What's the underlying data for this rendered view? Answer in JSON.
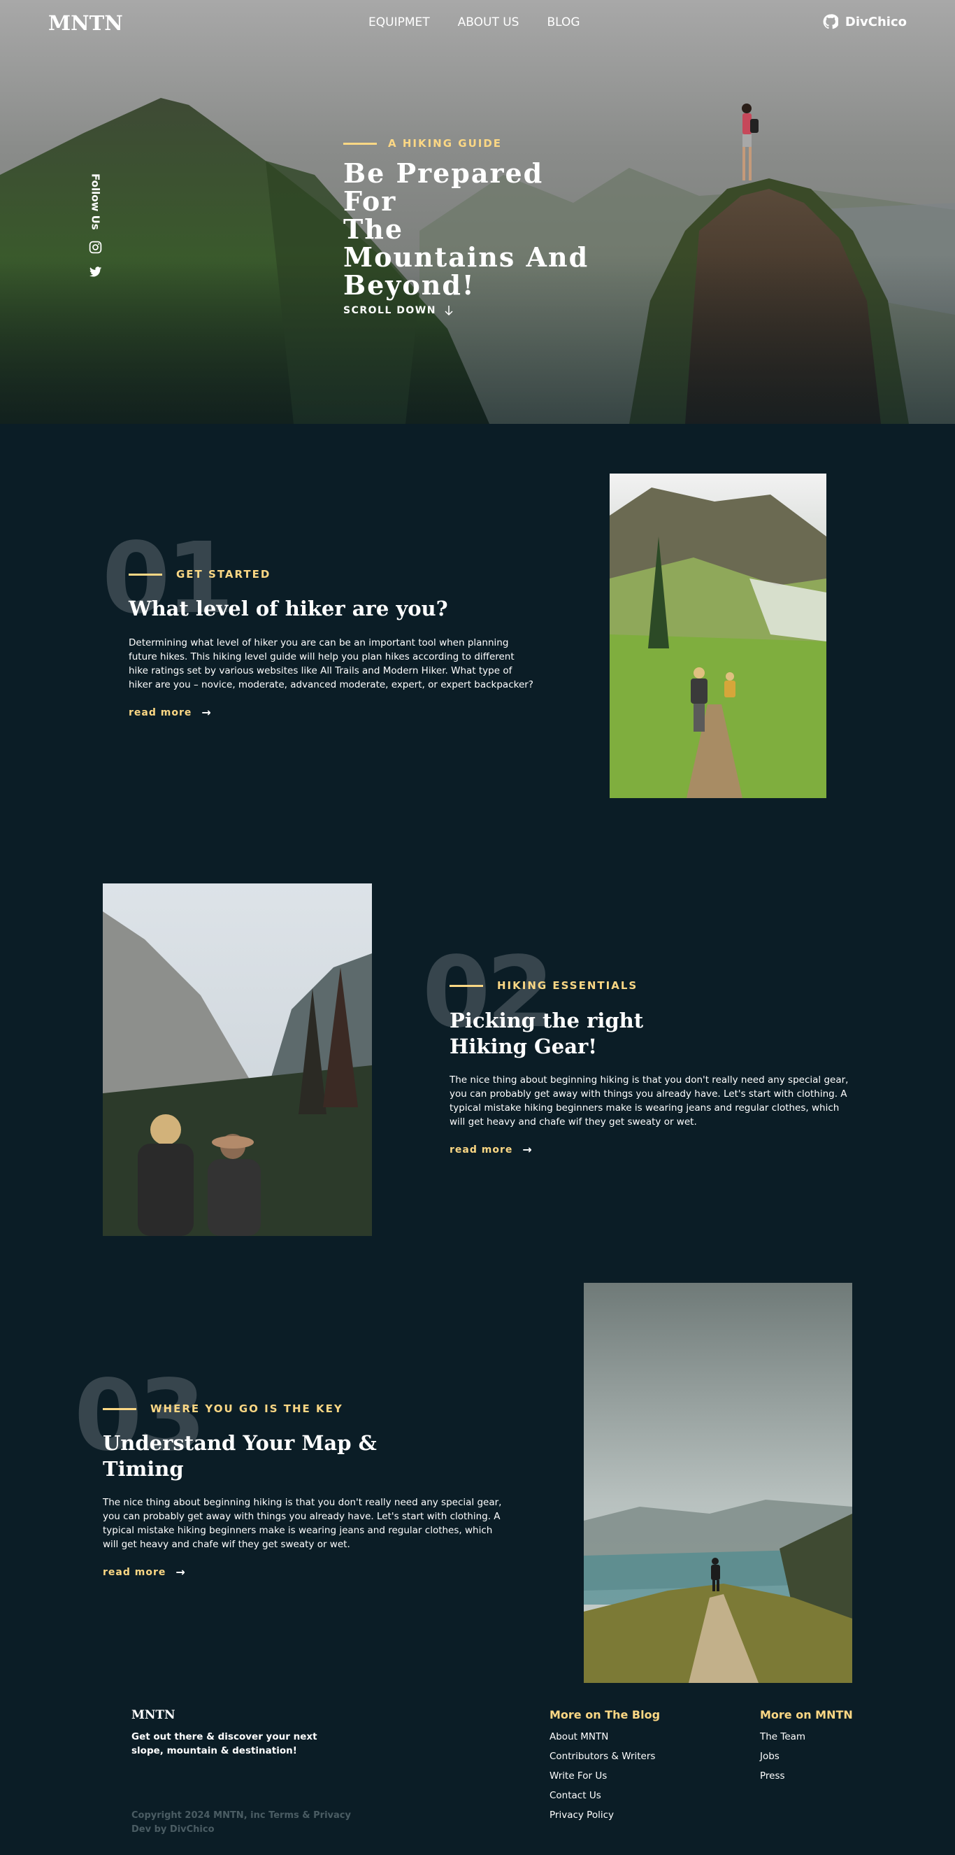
{
  "header": {
    "logo": "MNTN",
    "nav": [
      "EQUIPMET",
      "ABOUT US",
      "BLOG"
    ],
    "github_label": "DivChico"
  },
  "hero": {
    "follow_label": "Follow Us",
    "eyebrow": "A HIKING GUIDE",
    "title_lines": [
      "Be Prepared For",
      "The",
      "Mountains And",
      "Beyond!"
    ],
    "scroll_label": "SCROLL DOWN"
  },
  "sections": [
    {
      "number": "01",
      "eyebrow": "GET STARTED",
      "title": "What level of hiker are you?",
      "body": "Determining what level of hiker you are can be an important tool when planning future hikes. This hiking level guide will help you plan hikes according to different hike ratings set by various websites like All Trails and Modern Hiker. What type of hiker are you – novice, moderate, advanced moderate, expert, or expert backpacker?",
      "read_more": "read more"
    },
    {
      "number": "02",
      "eyebrow": "HIKING ESSENTIALS",
      "title": "Picking the right Hiking Gear!",
      "body": "The nice thing about beginning hiking is that you don't really need any special gear, you can probably get away with things you already have. Let's start with clothing. A typical mistake hiking beginners make is wearing jeans and regular clothes, which will get heavy and chafe wif they get sweaty or wet.",
      "read_more": "read more"
    },
    {
      "number": "03",
      "eyebrow": "WHERE YOU GO IS THE KEY",
      "title": "Understand Your Map & Timing",
      "body": "The nice thing about beginning hiking is that you don't really need any special gear, you can probably get away with things you already have. Let's start with clothing. A typical mistake hiking beginners make is wearing jeans and regular clothes, which will get heavy and chafe wif they get sweaty or wet.",
      "read_more": "read more"
    }
  ],
  "footer": {
    "logo": "MNTN",
    "tagline": "Get out there & discover your next slope, mountain & destination!",
    "copyright": "Copyright 2024 MNTN, inc Terms & Privacy",
    "dev_credit": "Dev by DivChico",
    "blog_heading": "More on The Blog",
    "blog_links": [
      "About MNTN",
      "Contributors & Writers",
      "Write For Us",
      "Contact Us",
      "Privacy Policy"
    ],
    "mntn_heading": "More on MNTN",
    "mntn_links": [
      "The Team",
      "Jobs",
      "Press"
    ]
  },
  "colors": {
    "background": "#0b1d26",
    "accent": "#fbd784"
  },
  "icons": [
    "github-icon",
    "instagram-icon",
    "twitter-icon",
    "arrow-down-icon",
    "arrow-right-icon"
  ]
}
